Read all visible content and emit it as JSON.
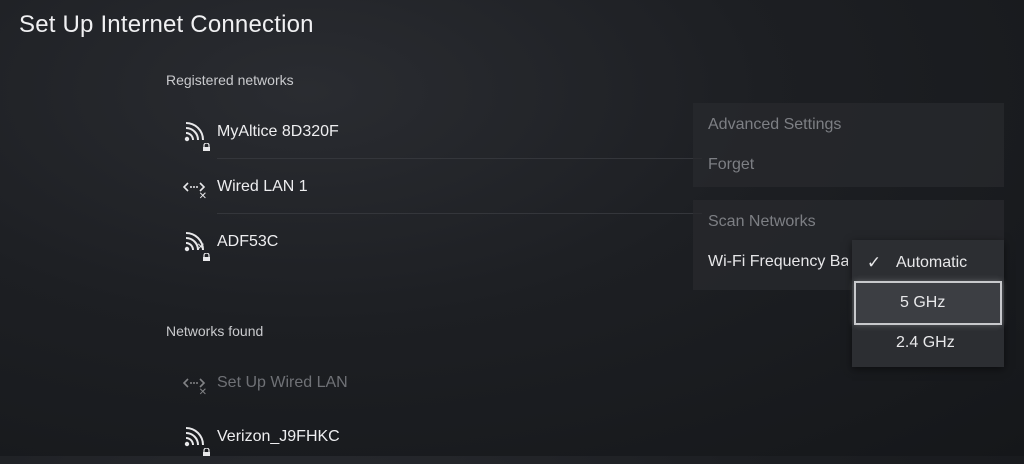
{
  "title": "Set Up Internet Connection",
  "registered": {
    "header": "Registered networks",
    "items": [
      {
        "label": "MyAltice 8D320F"
      },
      {
        "label": "Wired LAN 1"
      },
      {
        "label": "ADF53C"
      }
    ]
  },
  "found": {
    "header": "Networks found",
    "items": [
      {
        "label": "Set Up Wired LAN"
      },
      {
        "label": "Verizon_J9FHKC"
      }
    ]
  },
  "menu": {
    "advanced": "Advanced Settings",
    "forget": "Forget",
    "scan": "Scan Networks",
    "wifi_band": "Wi-Fi Frequency Ba"
  },
  "dropdown": {
    "options": [
      "Automatic",
      "5 GHz",
      "2.4 GHz"
    ],
    "checked": "Automatic",
    "focused": "5 GHz",
    "check_glyph": "✓"
  }
}
